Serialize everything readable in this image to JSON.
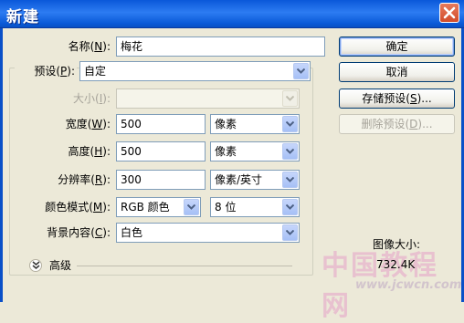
{
  "window": {
    "title": "新建"
  },
  "fields": {
    "name": {
      "label": "名称",
      "key": "N",
      "value": "梅花"
    },
    "preset": {
      "label": "预设",
      "key": "P",
      "value": "自定"
    },
    "size": {
      "label": "大小",
      "key": "I",
      "value": ""
    },
    "width": {
      "label": "宽度",
      "key": "W",
      "value": "500",
      "unit": "像素"
    },
    "height": {
      "label": "高度",
      "key": "H",
      "value": "500",
      "unit": "像素"
    },
    "resolution": {
      "label": "分辨率",
      "key": "R",
      "value": "300",
      "unit": "像素/英寸"
    },
    "color_mode": {
      "label": "颜色模式",
      "key": "M",
      "value": "RGB 颜色",
      "depth": "8 位"
    },
    "background": {
      "label": "背景内容",
      "key": "C",
      "value": "白色"
    }
  },
  "advanced_label": "高级",
  "buttons": {
    "ok": "确定",
    "cancel": "取消",
    "save_preset": {
      "text": "存储预设",
      "key": "S",
      "suffix": "..."
    },
    "delete_preset": {
      "text": "删除预设",
      "key": "D",
      "suffix": "..."
    }
  },
  "image_size": {
    "label": "图像大小:",
    "value": "732.4K"
  },
  "watermark": {
    "text": "中国教程网",
    "url": "www.jcwcn.com"
  },
  "colors": {
    "titlebar": "#0a58d9",
    "dialog_bg": "#ece9d8",
    "close_button": "#d24c2a"
  },
  "icons": [
    "close-icon",
    "dropdown-arrow-icon",
    "expand-chevron-icon"
  ]
}
